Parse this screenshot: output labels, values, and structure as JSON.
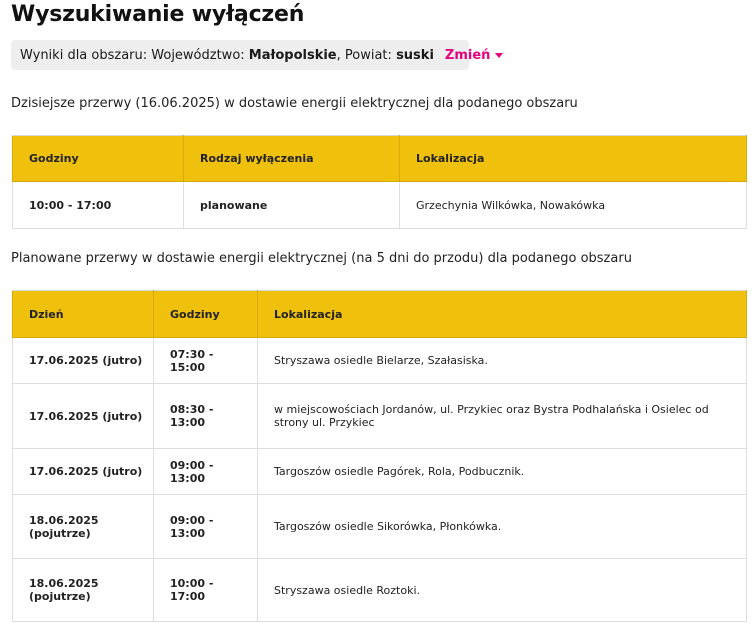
{
  "page": {
    "title": "Wyszukiwanie wyłączeń"
  },
  "area": {
    "prefix": "Wyniki dla obszaru: Województwo:",
    "voivodeship": "Małopolskie",
    "powiat_label": ", Powiat:",
    "powiat": "suski",
    "change_label": "Zmień"
  },
  "today": {
    "heading": "Dzisiejsze przerwy (16.06.2025) w dostawie energii elektrycznej dla podanego obszaru",
    "columns": [
      "Godziny",
      "Rodzaj wyłączenia",
      "Lokalizacja"
    ],
    "rows": [
      {
        "hours": "10:00 - 17:00",
        "type": "planowane",
        "location": "Grzechynia Wilkówka, Nowakówka"
      }
    ]
  },
  "planned": {
    "heading": "Planowane przerwy w dostawie energii elektrycznej (na 5 dni do przodu) dla podanego obszaru",
    "columns": [
      "Dzień",
      "Godziny",
      "Lokalizacja"
    ],
    "rows": [
      {
        "day": "17.06.2025 (jutro)",
        "hours": "07:30 - 15:00",
        "location": "Stryszawa osiedle Bielarze, Szałasiska."
      },
      {
        "day": "17.06.2025 (jutro)",
        "hours": "08:30 - 13:00",
        "location": "w miejscowościach Jordanów, ul. Przykiec oraz Bystra Podhalańska i Osielec od strony ul. Przykiec"
      },
      {
        "day": "17.06.2025 (jutro)",
        "hours": "09:00 - 13:00",
        "location": "Targoszów osiedle Pagórek, Rola, Podbucznik."
      },
      {
        "day": "18.06.2025 (pojutrze)",
        "hours": "09:00 - 13:00",
        "location": "Targoszów osiedle Sikorówka, Płonkówka."
      },
      {
        "day": "18.06.2025 (pojutrze)",
        "hours": "10:00 - 17:00",
        "location": "Stryszawa osiedle Roztoki."
      }
    ]
  }
}
